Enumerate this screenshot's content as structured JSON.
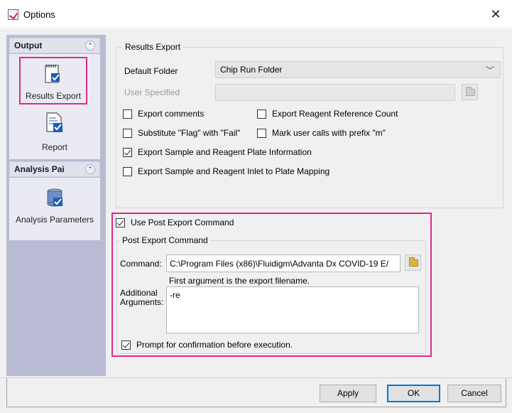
{
  "window": {
    "title": "Options",
    "close_glyph": "✕"
  },
  "nav": {
    "sections": [
      {
        "label": "Output",
        "toggle": "⌃"
      },
      {
        "label": "Analysis Pai",
        "toggle": "⌃"
      }
    ],
    "output_items": [
      {
        "label": "Results Export",
        "icon": "results-export-icon",
        "selected": true
      },
      {
        "label": "Report",
        "icon": "report-icon",
        "selected": false
      }
    ],
    "analysis_items": [
      {
        "label": "Analysis Parameters",
        "icon": "analysis-parameters-icon",
        "selected": false
      }
    ]
  },
  "results_export": {
    "group_title": "Results Export",
    "default_folder_label": "Default Folder",
    "default_folder_value": "Chip Run Folder",
    "user_specified_label": "User Specified",
    "user_specified_value": "",
    "options": [
      {
        "label": "Export comments",
        "checked": false
      },
      {
        "label": "Export Reagent Reference Count",
        "checked": false
      },
      {
        "label": "Substitute \"Flag\" with \"Fail\"",
        "checked": false
      },
      {
        "label": "Mark user calls with prefix \"m\"",
        "checked": false
      },
      {
        "label": "Export Sample and Reagent Plate Information",
        "checked": true
      },
      {
        "label": "Export Sample and Reagent Inlet to Plate Mapping",
        "checked": false
      }
    ]
  },
  "post_export": {
    "use_label": "Use Post Export Command",
    "use_checked": true,
    "group_title": "Post Export Command",
    "command_label": "Command:",
    "command_value": "C:\\Program Files (x86)\\Fluidigm\\Advanta Dx COVID-19 E/",
    "command_hint": "First argument is the export filename.",
    "args_label_1": "Additional",
    "args_label_2": "Arguments:",
    "args_value": "-re",
    "prompt_label": "Prompt for confirmation before execution.",
    "prompt_checked": true
  },
  "buttons": {
    "apply": "Apply",
    "ok": "OK",
    "cancel": "Cancel"
  },
  "colors": {
    "highlight": "#e0288f",
    "nav_bg": "#b8bbd3",
    "default_button": "#0078d7"
  }
}
